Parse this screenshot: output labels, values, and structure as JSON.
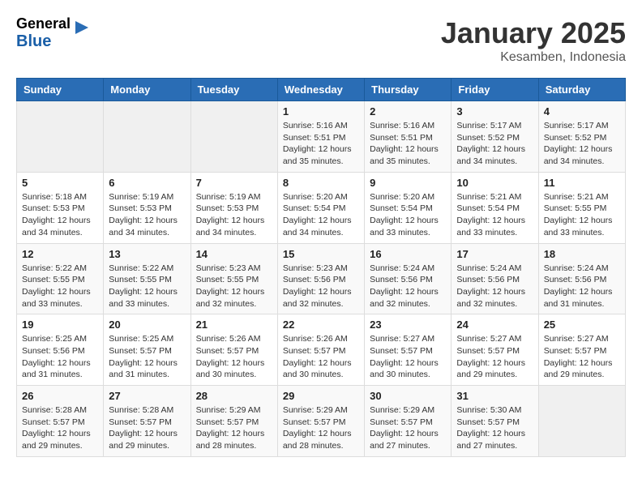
{
  "header": {
    "logo_general": "General",
    "logo_blue": "Blue",
    "month": "January 2025",
    "location": "Kesamben, Indonesia"
  },
  "weekdays": [
    "Sunday",
    "Monday",
    "Tuesday",
    "Wednesday",
    "Thursday",
    "Friday",
    "Saturday"
  ],
  "weeks": [
    [
      {
        "day": "",
        "info": ""
      },
      {
        "day": "",
        "info": ""
      },
      {
        "day": "",
        "info": ""
      },
      {
        "day": "1",
        "info": "Sunrise: 5:16 AM\nSunset: 5:51 PM\nDaylight: 12 hours\nand 35 minutes."
      },
      {
        "day": "2",
        "info": "Sunrise: 5:16 AM\nSunset: 5:51 PM\nDaylight: 12 hours\nand 35 minutes."
      },
      {
        "day": "3",
        "info": "Sunrise: 5:17 AM\nSunset: 5:52 PM\nDaylight: 12 hours\nand 34 minutes."
      },
      {
        "day": "4",
        "info": "Sunrise: 5:17 AM\nSunset: 5:52 PM\nDaylight: 12 hours\nand 34 minutes."
      }
    ],
    [
      {
        "day": "5",
        "info": "Sunrise: 5:18 AM\nSunset: 5:53 PM\nDaylight: 12 hours\nand 34 minutes."
      },
      {
        "day": "6",
        "info": "Sunrise: 5:19 AM\nSunset: 5:53 PM\nDaylight: 12 hours\nand 34 minutes."
      },
      {
        "day": "7",
        "info": "Sunrise: 5:19 AM\nSunset: 5:53 PM\nDaylight: 12 hours\nand 34 minutes."
      },
      {
        "day": "8",
        "info": "Sunrise: 5:20 AM\nSunset: 5:54 PM\nDaylight: 12 hours\nand 34 minutes."
      },
      {
        "day": "9",
        "info": "Sunrise: 5:20 AM\nSunset: 5:54 PM\nDaylight: 12 hours\nand 33 minutes."
      },
      {
        "day": "10",
        "info": "Sunrise: 5:21 AM\nSunset: 5:54 PM\nDaylight: 12 hours\nand 33 minutes."
      },
      {
        "day": "11",
        "info": "Sunrise: 5:21 AM\nSunset: 5:55 PM\nDaylight: 12 hours\nand 33 minutes."
      }
    ],
    [
      {
        "day": "12",
        "info": "Sunrise: 5:22 AM\nSunset: 5:55 PM\nDaylight: 12 hours\nand 33 minutes."
      },
      {
        "day": "13",
        "info": "Sunrise: 5:22 AM\nSunset: 5:55 PM\nDaylight: 12 hours\nand 33 minutes."
      },
      {
        "day": "14",
        "info": "Sunrise: 5:23 AM\nSunset: 5:55 PM\nDaylight: 12 hours\nand 32 minutes."
      },
      {
        "day": "15",
        "info": "Sunrise: 5:23 AM\nSunset: 5:56 PM\nDaylight: 12 hours\nand 32 minutes."
      },
      {
        "day": "16",
        "info": "Sunrise: 5:24 AM\nSunset: 5:56 PM\nDaylight: 12 hours\nand 32 minutes."
      },
      {
        "day": "17",
        "info": "Sunrise: 5:24 AM\nSunset: 5:56 PM\nDaylight: 12 hours\nand 32 minutes."
      },
      {
        "day": "18",
        "info": "Sunrise: 5:24 AM\nSunset: 5:56 PM\nDaylight: 12 hours\nand 31 minutes."
      }
    ],
    [
      {
        "day": "19",
        "info": "Sunrise: 5:25 AM\nSunset: 5:56 PM\nDaylight: 12 hours\nand 31 minutes."
      },
      {
        "day": "20",
        "info": "Sunrise: 5:25 AM\nSunset: 5:57 PM\nDaylight: 12 hours\nand 31 minutes."
      },
      {
        "day": "21",
        "info": "Sunrise: 5:26 AM\nSunset: 5:57 PM\nDaylight: 12 hours\nand 30 minutes."
      },
      {
        "day": "22",
        "info": "Sunrise: 5:26 AM\nSunset: 5:57 PM\nDaylight: 12 hours\nand 30 minutes."
      },
      {
        "day": "23",
        "info": "Sunrise: 5:27 AM\nSunset: 5:57 PM\nDaylight: 12 hours\nand 30 minutes."
      },
      {
        "day": "24",
        "info": "Sunrise: 5:27 AM\nSunset: 5:57 PM\nDaylight: 12 hours\nand 29 minutes."
      },
      {
        "day": "25",
        "info": "Sunrise: 5:27 AM\nSunset: 5:57 PM\nDaylight: 12 hours\nand 29 minutes."
      }
    ],
    [
      {
        "day": "26",
        "info": "Sunrise: 5:28 AM\nSunset: 5:57 PM\nDaylight: 12 hours\nand 29 minutes."
      },
      {
        "day": "27",
        "info": "Sunrise: 5:28 AM\nSunset: 5:57 PM\nDaylight: 12 hours\nand 29 minutes."
      },
      {
        "day": "28",
        "info": "Sunrise: 5:29 AM\nSunset: 5:57 PM\nDaylight: 12 hours\nand 28 minutes."
      },
      {
        "day": "29",
        "info": "Sunrise: 5:29 AM\nSunset: 5:57 PM\nDaylight: 12 hours\nand 28 minutes."
      },
      {
        "day": "30",
        "info": "Sunrise: 5:29 AM\nSunset: 5:57 PM\nDaylight: 12 hours\nand 27 minutes."
      },
      {
        "day": "31",
        "info": "Sunrise: 5:30 AM\nSunset: 5:57 PM\nDaylight: 12 hours\nand 27 minutes."
      },
      {
        "day": "",
        "info": ""
      }
    ]
  ]
}
